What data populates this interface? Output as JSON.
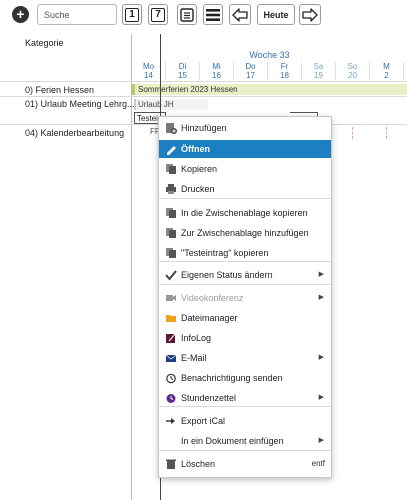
{
  "toolbar": {
    "add_label": "+",
    "search_placeholder": "Suche",
    "day_view_label": "1",
    "week_view_label": "7",
    "today_label": "Heute"
  },
  "calendar": {
    "category_header": "Kategorie",
    "week_label": "Woche 33",
    "days": [
      {
        "name": "Mo",
        "num": "14"
      },
      {
        "name": "Di",
        "num": "15"
      },
      {
        "name": "Mi",
        "num": "16"
      },
      {
        "name": "Do",
        "num": "17"
      },
      {
        "name": "Fr",
        "num": "18"
      },
      {
        "name": "Sa",
        "num": "19"
      },
      {
        "name": "So",
        "num": "20"
      },
      {
        "name": "M",
        "num": "2"
      }
    ],
    "rows": [
      {
        "label": "0) Ferien Hessen"
      },
      {
        "label": "01) Urlaub Meeting Lehrg..."
      },
      {
        "label": ""
      },
      {
        "label": "04) Kalenderbearbeitung"
      }
    ],
    "events": {
      "holiday": "Sommerferien 2023 Hessen",
      "urlaub": "Urlaub JH",
      "test": "Testei",
      "stub": "FF"
    }
  },
  "context_menu": {
    "items": [
      {
        "label": "Hinzufügen",
        "icon": "add-document-icon"
      },
      {
        "label": "Öffnen",
        "icon": "pencil-icon",
        "active": true
      },
      {
        "label": "Kopieren",
        "icon": "copy-icon"
      },
      {
        "label": "Drucken",
        "icon": "printer-icon"
      },
      {
        "label": "In die Zwischenablage kopieren",
        "icon": "clipboard-copy-icon"
      },
      {
        "label": "Zur Zwischenablage hinzufügen",
        "icon": "clipboard-add-icon"
      },
      {
        "label": "\"Testeintrag\" kopieren",
        "icon": "clipboard-text-icon"
      },
      {
        "label": "Eigenen Status ändern",
        "icon": "checkmark-icon",
        "submenu": true
      },
      {
        "label": "Videokonferenz",
        "icon": "video-camera-icon",
        "submenu": true,
        "disabled": true
      },
      {
        "label": "Dateimanager",
        "icon": "folder-icon"
      },
      {
        "label": "InfoLog",
        "icon": "infolog-icon"
      },
      {
        "label": "E-Mail",
        "icon": "envelope-icon",
        "submenu": true
      },
      {
        "label": "Benachrichtigung senden",
        "icon": "alarm-clock-icon"
      },
      {
        "label": "Stundenzettel",
        "icon": "stopwatch-icon",
        "submenu": true
      },
      {
        "label": "Export iCal",
        "icon": "export-arrow-icon"
      },
      {
        "label": "In ein Dokument einfügen",
        "icon": "",
        "submenu": true
      },
      {
        "label": "Löschen",
        "icon": "trash-icon",
        "shortcut": "entf"
      }
    ]
  },
  "colors": {
    "accent": "#1b7fc2",
    "week_header": "#3570a8",
    "holiday_bar": "#e9efc6"
  }
}
